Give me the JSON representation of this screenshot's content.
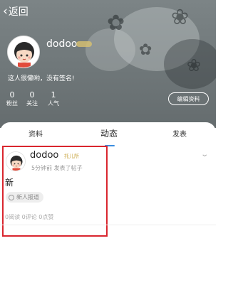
{
  "header": {
    "back_label": "返回",
    "username": "dodoo",
    "signature": "这人很懒哟，没有签名!",
    "stats": [
      {
        "num": "0",
        "label": "粉丝"
      },
      {
        "num": "0",
        "label": "关注"
      },
      {
        "num": "1",
        "label": "人气"
      }
    ],
    "edit_label": "编辑资料"
  },
  "tabs": [
    {
      "label": "资料"
    },
    {
      "label": "动态"
    },
    {
      "label": "发表"
    }
  ],
  "active_tab": "动态",
  "post": {
    "author": "dodoo",
    "level": "托儿所",
    "meta": "5分钟前  发表了帖子",
    "content": "新",
    "tag": "新人报道",
    "stats": "0阅读 0评论 0点赞"
  },
  "colors": {
    "accent": "#3c8ee0",
    "highlight_box": "#d9262e"
  }
}
